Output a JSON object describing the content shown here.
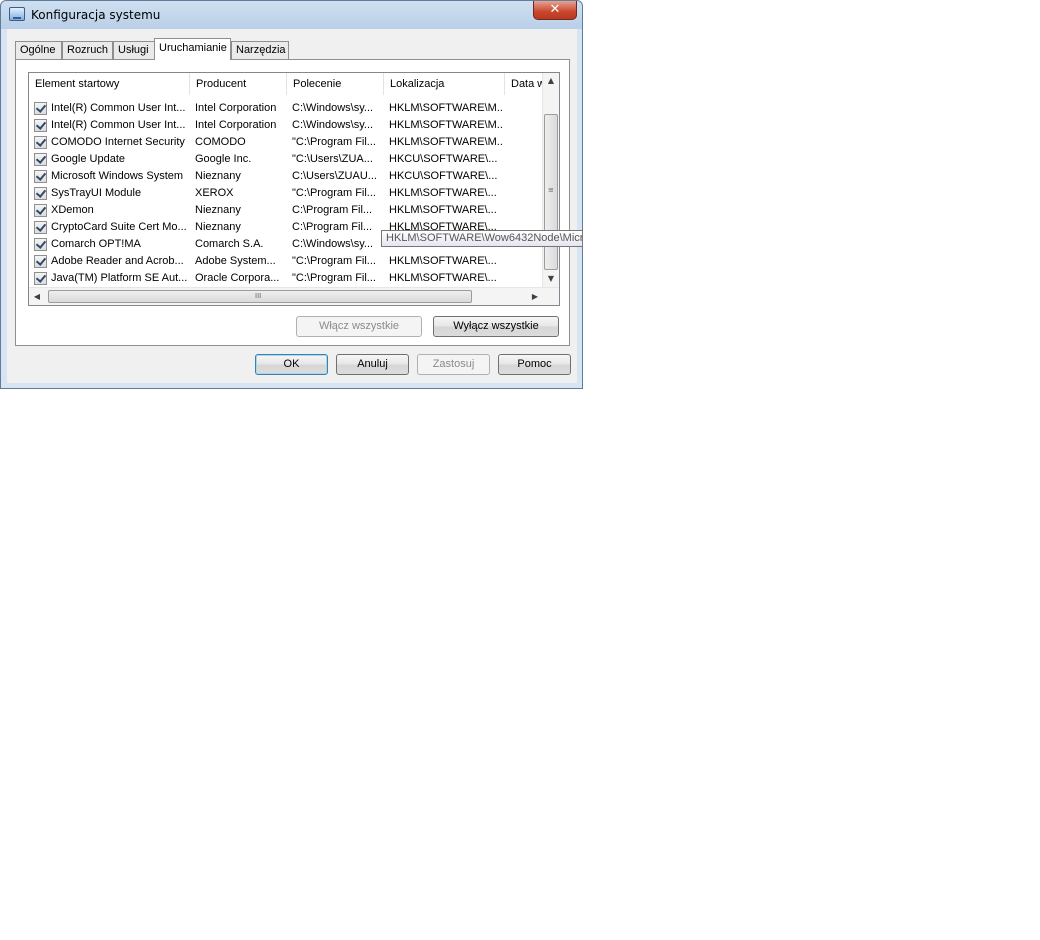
{
  "window": {
    "title": "Konfiguracja systemu",
    "close_label": "✕"
  },
  "tabs": [
    {
      "label": "Ogólne"
    },
    {
      "label": "Rozruch"
    },
    {
      "label": "Usługi"
    },
    {
      "label": "Uruchamianie",
      "active": true
    },
    {
      "label": "Narzędzia"
    }
  ],
  "columns": [
    {
      "label": "Element startowy"
    },
    {
      "label": "Producent"
    },
    {
      "label": "Polecenie"
    },
    {
      "label": "Lokalizacja"
    },
    {
      "label": "Data w"
    }
  ],
  "rows": [
    {
      "checked": true,
      "name": "Intel(R) Common User Int...",
      "vendor": "Intel Corporation",
      "command": "C:\\Windows\\sy...",
      "location": "HKLM\\SOFTWARE\\M..."
    },
    {
      "checked": true,
      "name": "Intel(R) Common User Int...",
      "vendor": "Intel Corporation",
      "command": "C:\\Windows\\sy...",
      "location": "HKLM\\SOFTWARE\\M..."
    },
    {
      "checked": true,
      "name": "COMODO Internet Security",
      "vendor": "COMODO",
      "command": "\"C:\\Program Fil...",
      "location": "HKLM\\SOFTWARE\\M..."
    },
    {
      "checked": true,
      "name": "Google Update",
      "vendor": "Google Inc.",
      "command": "\"C:\\Users\\ZUA...",
      "location": "HKCU\\SOFTWARE\\..."
    },
    {
      "checked": true,
      "name": "Microsoft Windows System",
      "vendor": "Nieznany",
      "command": "C:\\Users\\ZUAU...",
      "location": "HKCU\\SOFTWARE\\..."
    },
    {
      "checked": true,
      "name": "SysTrayUI Module",
      "vendor": "XEROX",
      "command": "\"C:\\Program Fil...",
      "location": "HKLM\\SOFTWARE\\..."
    },
    {
      "checked": true,
      "name": "XDemon",
      "vendor": "Nieznany",
      "command": "C:\\Program Fil...",
      "location": "HKLM\\SOFTWARE\\..."
    },
    {
      "checked": true,
      "name": "CryptoCard Suite Cert Mo...",
      "vendor": "Nieznany",
      "command": "C:\\Program Fil...",
      "location": "HKLM\\SOFTWARE\\..."
    },
    {
      "checked": true,
      "name": "Comarch OPT!MA",
      "vendor": "Comarch S.A.",
      "command": "C:\\Windows\\sy...",
      "location": "HKLM\\SOFTWARE\\Wow6432Node\\Micros"
    },
    {
      "checked": true,
      "name": "Adobe Reader and Acrob...",
      "vendor": "Adobe System...",
      "command": "\"C:\\Program Fil...",
      "location": "HKLM\\SOFTWARE\\..."
    },
    {
      "checked": true,
      "name": "Java(TM) Platform SE Aut...",
      "vendor": "Oracle Corpora...",
      "command": "\"C:\\Program Fil...",
      "location": "HKLM\\SOFTWARE\\..."
    }
  ],
  "tooltip": "HKLM\\SOFTWARE\\Wow6432Node\\Micros",
  "panel_buttons": {
    "enable_all": "Włącz wszystkie",
    "disable_all": "Wyłącz wszystkie"
  },
  "dialog_buttons": {
    "ok": "OK",
    "cancel": "Anuluj",
    "apply": "Zastosuj",
    "help": "Pomoc"
  },
  "scrollbar": {
    "up_arrow": "▲",
    "down_arrow": "▼",
    "left_arrow": "◀",
    "right_arrow": "▶",
    "v_grip": "≡",
    "h_grip": "III"
  }
}
